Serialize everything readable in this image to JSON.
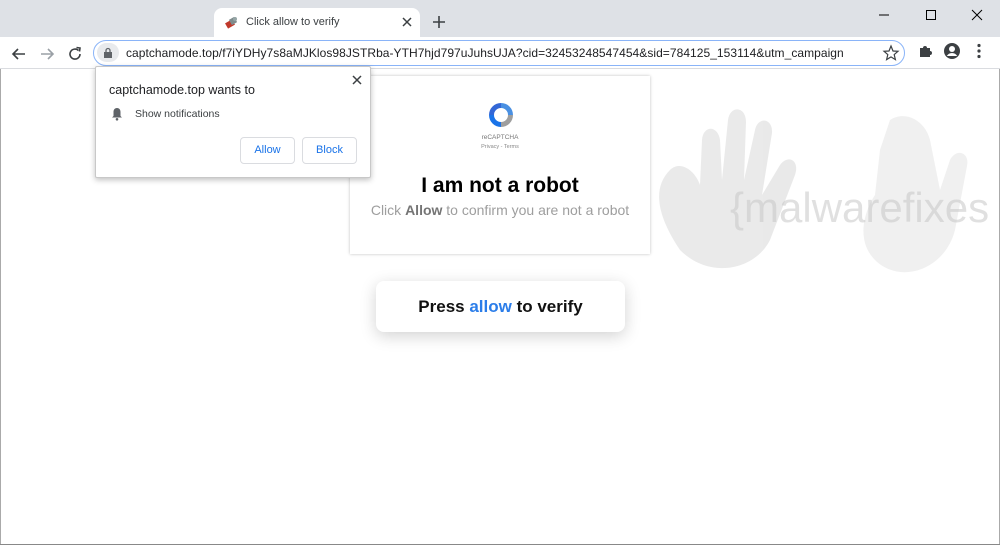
{
  "browser": {
    "tab_title": "Click allow to verify",
    "url": "captchamode.top/f7iYDHy7s8aMJKlos98JSTRba-YTH7hjd797uJuhsUJA?cid=32453248547454&sid=784125_153114&utm_campaign"
  },
  "permission_popup": {
    "title": "captchamode.top wants to",
    "permission": "Show notifications",
    "allow_label": "Allow",
    "block_label": "Block"
  },
  "captcha": {
    "brand": "reCAPTCHA",
    "privacy": "Privacy",
    "separator": " - ",
    "terms": "Terms",
    "title": "I am not a robot",
    "sub_prefix": "Click ",
    "sub_bold": "Allow",
    "sub_suffix": " to confirm you are not a robot"
  },
  "verify": {
    "prefix": "Press ",
    "highlight": "allow",
    "suffix": " to verify"
  },
  "watermark": {
    "text": "{malwarefixes"
  },
  "colors": {
    "accent": "#1a73e8",
    "highlight": "#2b7de9",
    "chrome_bg": "#dee1e6"
  }
}
